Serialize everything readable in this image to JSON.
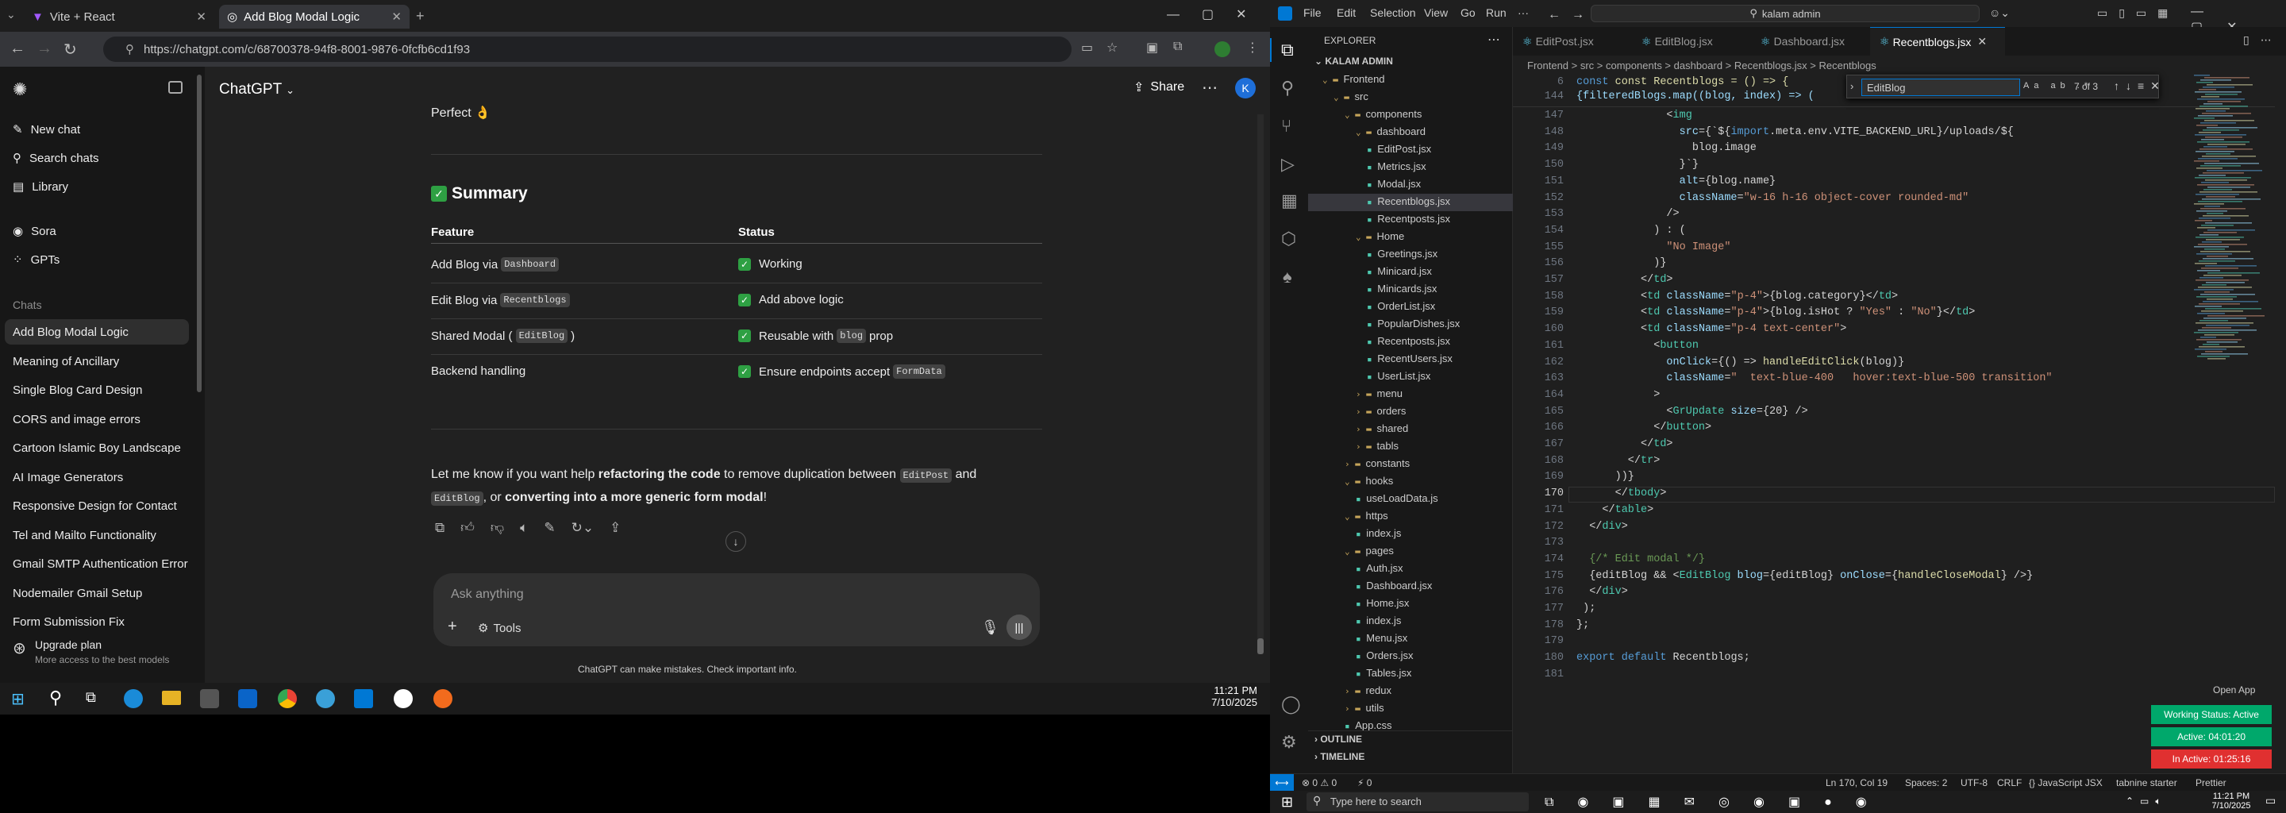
{
  "browser": {
    "tab1": "Vite + React",
    "tab2": "Add Blog Modal Logic",
    "url": "https://chatgpt.com/c/68700378-94f8-8001-9876-0fcfb6cd1f93"
  },
  "chatgpt": {
    "brand": "ChatGPT",
    "share": "Share",
    "sidebar_items": [
      "New chat",
      "Search chats",
      "Library",
      "Sora",
      "GPTs"
    ],
    "chats_heading": "Chats",
    "chats": [
      "Add Blog Modal Logic",
      "Meaning of Ancillary",
      "Single Blog Card Design",
      "CORS and image errors",
      "Cartoon Islamic Boy Landscape",
      "AI Image Generators",
      "Responsive Design for Contact",
      "Tel and Mailto Functionality",
      "Gmail SMTP Authentication Error",
      "Nodemailer Gmail Setup",
      "Form Submission Fix"
    ],
    "upgrade_title": "Upgrade plan",
    "upgrade_sub": "More access to the best models",
    "perfect": "Perfect 👌",
    "summary_title": "Summary",
    "col_feature": "Feature",
    "col_status": "Status",
    "rows": [
      {
        "f_pre": "Add Blog via",
        "f_code": "Dashboard",
        "f_post": "",
        "s_pre": "Working",
        "s_code": "",
        "s_post": ""
      },
      {
        "f_pre": "Edit Blog via",
        "f_code": "Recentblogs",
        "f_post": "",
        "s_pre": "Add above logic",
        "s_code": "",
        "s_post": ""
      },
      {
        "f_pre": "Shared Modal (",
        "f_code": "EditBlog",
        "f_post": ")",
        "s_pre": "Reusable with",
        "s_code": "blog",
        "s_post": "prop"
      },
      {
        "f_pre": "Backend handling",
        "f_code": "",
        "f_post": "",
        "s_pre": "Ensure endpoints accept",
        "s_code": "FormData",
        "s_post": ""
      }
    ],
    "closing_1": "Let me know if you want help ",
    "closing_b1": "refactoring the code",
    "closing_2": " to remove duplication between ",
    "closing_c1": "EditPost",
    "closing_3": " and",
    "closing_c2": "EditBlog",
    "closing_4": ", or ",
    "closing_b2": "converting into a more generic form modal",
    "closing_5": "!",
    "input_placeholder": "Ask anything",
    "tools": "Tools",
    "disclaimer": "ChatGPT can make mistakes. Check important info."
  },
  "taskbar_left": {
    "time": "11:21 PM",
    "date": "7/10/2025"
  },
  "vscode": {
    "menu": [
      "File",
      "Edit",
      "Selection",
      "View",
      "Go",
      "Run",
      "···"
    ],
    "search": "kalam admin",
    "explorer_title": "EXPLORER",
    "workspace": "KALAM ADMIN",
    "tree": [
      {
        "d": 1,
        "n": "Frontend",
        "folder": true
      },
      {
        "d": 2,
        "n": "src",
        "folder": true
      },
      {
        "d": 3,
        "n": "components",
        "folder": true
      },
      {
        "d": 4,
        "n": "dashboard",
        "folder": true
      },
      {
        "d": 5,
        "n": "EditPost.jsx"
      },
      {
        "d": 5,
        "n": "Metrics.jsx"
      },
      {
        "d": 5,
        "n": "Modal.jsx"
      },
      {
        "d": 5,
        "n": "Recentblogs.jsx",
        "sel": true
      },
      {
        "d": 5,
        "n": "Recentposts.jsx"
      },
      {
        "d": 4,
        "n": "Home",
        "folder": true
      },
      {
        "d": 5,
        "n": "Greetings.jsx"
      },
      {
        "d": 5,
        "n": "Minicard.jsx"
      },
      {
        "d": 5,
        "n": "Minicards.jsx"
      },
      {
        "d": 5,
        "n": "OrderList.jsx"
      },
      {
        "d": 5,
        "n": "PopularDishes.jsx"
      },
      {
        "d": 5,
        "n": "Recentposts.jsx"
      },
      {
        "d": 5,
        "n": "RecentUsers.jsx"
      },
      {
        "d": 5,
        "n": "UserList.jsx"
      },
      {
        "d": 4,
        "n": "menu",
        "folder": true,
        "closed": true
      },
      {
        "d": 4,
        "n": "orders",
        "folder": true,
        "closed": true
      },
      {
        "d": 4,
        "n": "shared",
        "folder": true,
        "closed": true
      },
      {
        "d": 4,
        "n": "tabls",
        "folder": true,
        "closed": true
      },
      {
        "d": 3,
        "n": "constants",
        "folder": true,
        "closed": true
      },
      {
        "d": 3,
        "n": "hooks",
        "folder": true
      },
      {
        "d": 4,
        "n": "useLoadData.js"
      },
      {
        "d": 3,
        "n": "https",
        "folder": true
      },
      {
        "d": 4,
        "n": "index.js"
      },
      {
        "d": 3,
        "n": "pages",
        "folder": true
      },
      {
        "d": 4,
        "n": "Auth.jsx"
      },
      {
        "d": 4,
        "n": "Dashboard.jsx"
      },
      {
        "d": 4,
        "n": "Home.jsx"
      },
      {
        "d": 4,
        "n": "index.js"
      },
      {
        "d": 4,
        "n": "Menu.jsx"
      },
      {
        "d": 4,
        "n": "Orders.jsx"
      },
      {
        "d": 4,
        "n": "Tables.jsx"
      },
      {
        "d": 3,
        "n": "redux",
        "folder": true,
        "closed": true
      },
      {
        "d": 3,
        "n": "utils",
        "folder": true,
        "closed": true
      },
      {
        "d": 3,
        "n": "App.css"
      }
    ],
    "outline": "OUTLINE",
    "timeline": "TIMELINE",
    "tabs": [
      "EditPost.jsx",
      "EditBlog.jsx",
      "Dashboard.jsx",
      "Recentblogs.jsx"
    ],
    "breadcrumb": "Frontend > src > components > dashboard > Recentblogs.jsx > Recentblogs",
    "find_value": "EditBlog",
    "find_count": "7 of 3",
    "sticky": "const Recentblogs = () => {",
    "sticky2": "{filteredBlogs.map((blog, index) => (",
    "lines": [
      {
        "n": "147",
        "c": "              <img"
      },
      {
        "n": "148",
        "c": "                src={`${import.meta.env.VITE_BACKEND_URL}/uploads/${"
      },
      {
        "n": "149",
        "c": "                  blog.image"
      },
      {
        "n": "150",
        "c": "                }`}"
      },
      {
        "n": "151",
        "c": "                alt={blog.name}"
      },
      {
        "n": "152",
        "c": "                className=\"w-16 h-16 object-cover rounded-md\""
      },
      {
        "n": "153",
        "c": "              />"
      },
      {
        "n": "154",
        "c": "            ) : ("
      },
      {
        "n": "155",
        "c": "              \"No Image\""
      },
      {
        "n": "156",
        "c": "            )}"
      },
      {
        "n": "157",
        "c": "          </td>"
      },
      {
        "n": "158",
        "c": "          <td className=\"p-4\">{blog.category}</td>"
      },
      {
        "n": "159",
        "c": "          <td className=\"p-4\">{blog.isHot ? \"Yes\" : \"No\"}</td>"
      },
      {
        "n": "160",
        "c": "          <td className=\"p-4 text-center\">"
      },
      {
        "n": "161",
        "c": "            <button"
      },
      {
        "n": "162",
        "c": "              onClick={() => handleEditClick(blog)}"
      },
      {
        "n": "163",
        "c": "              className=\"  text-blue-400   hover:text-blue-500 transition\""
      },
      {
        "n": "164",
        "c": "            >"
      },
      {
        "n": "165",
        "c": "              <GrUpdate size={20} />"
      },
      {
        "n": "166",
        "c": "            </button>"
      },
      {
        "n": "167",
        "c": "          </td>"
      },
      {
        "n": "168",
        "c": "        </tr>"
      },
      {
        "n": "169",
        "c": "      ))}"
      },
      {
        "n": "170",
        "c": "      </tbody>"
      },
      {
        "n": "171",
        "c": "    </table>"
      },
      {
        "n": "172",
        "c": "  </div>"
      },
      {
        "n": "173",
        "c": ""
      },
      {
        "n": "174",
        "c": "  {/* Edit modal */}"
      },
      {
        "n": "175",
        "c": "  {editBlog && <EditBlog blog={editBlog} onClose={handleCloseModal} />}"
      },
      {
        "n": "176",
        "c": "  </div>"
      },
      {
        "n": "177",
        "c": " );"
      },
      {
        "n": "178",
        "c": "};"
      },
      {
        "n": "179",
        "c": ""
      },
      {
        "n": "180",
        "c": "export default Recentblogs;"
      },
      {
        "n": "181",
        "c": ""
      }
    ],
    "first_line_no": "6",
    "second_line_no": "144",
    "status_right": [
      "Ln 170, Col 19",
      "Spaces: 2",
      "UTF-8",
      "CRLF",
      "{} JavaScript JSX",
      "tabnine starter",
      "Prettier"
    ],
    "status_left": [
      "⊗ 0 ⚠ 0",
      "⚡ 0"
    ],
    "open_app": "Open App",
    "work_status": "Working Status: Active",
    "active_time": "Active: 04:01:20",
    "inactive_time": "In Active: 01:25:16",
    "search_placeholder": "Type here to search",
    "time": "11:21 PM",
    "date": "7/10/2025",
    "colors": {
      "accent": "#0078d4",
      "green": "#00a86b",
      "red": "#e03030"
    }
  }
}
